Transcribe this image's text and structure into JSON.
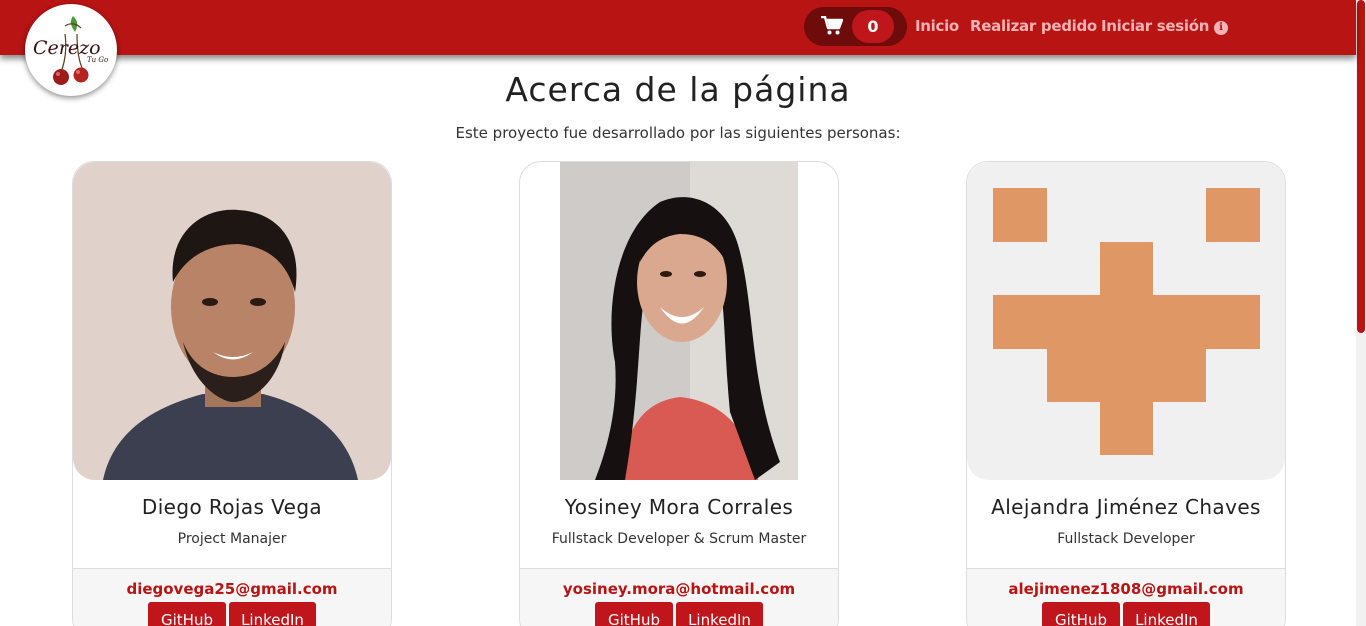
{
  "header": {
    "logo_text": "Cerezo's Tu Go",
    "cart": {
      "count": "0",
      "icon": "shopping-cart-icon"
    },
    "nav": {
      "home": "Inicio",
      "order": "Realizar pedido",
      "login": "Iniciar sesión"
    },
    "info_icon": "info-circle-icon"
  },
  "main": {
    "title": "Acerca de la página",
    "subtitle": "Este proyecto fue desarrollado por las siguientes personas:"
  },
  "team": [
    {
      "name": "Diego Rojas Vega",
      "role": "Project Manajer",
      "email": "diegovega25@gmail.com",
      "github": "GitHub",
      "linkedin": "LinkedIn"
    },
    {
      "name": "Yosiney Mora Corrales",
      "role": "Fullstack Developer & Scrum Master",
      "email": "yosiney.mora@hotmail.com",
      "github": "GitHub",
      "linkedin": "LinkedIn"
    },
    {
      "name": "Alejandra Jiménez Chaves",
      "role": "Fullstack Developer",
      "email": "alejimenez1808@gmail.com",
      "github": "GitHub",
      "linkedin": "LinkedIn"
    }
  ],
  "colors": {
    "brand": "#b81414",
    "brand_dark": "#6e0b0b",
    "link": "#f0b3b3",
    "identicon": "#de9765"
  }
}
